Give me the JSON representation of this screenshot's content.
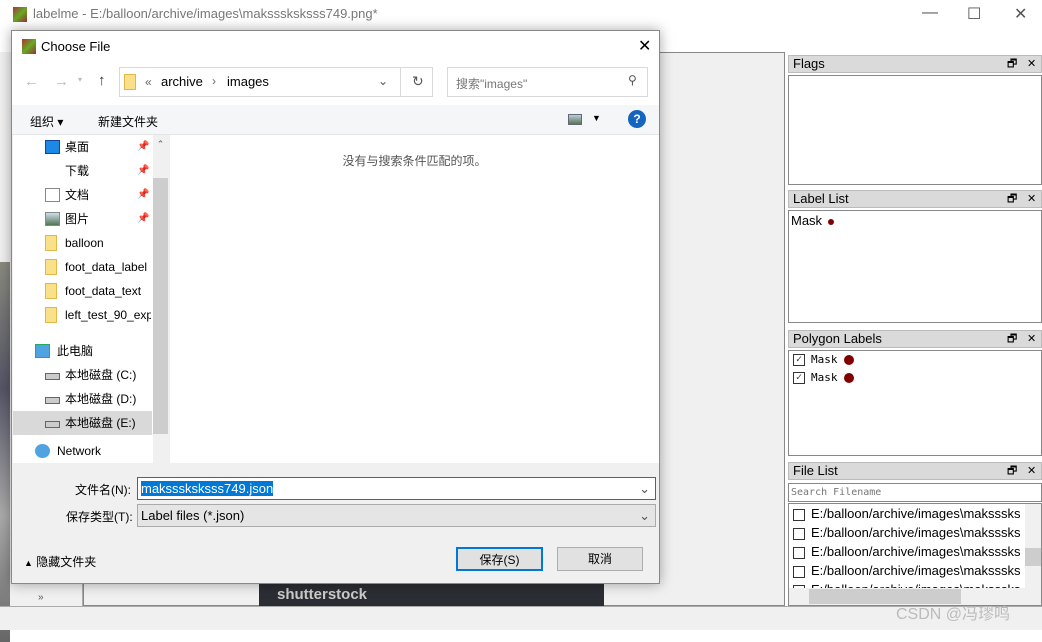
{
  "main_window": {
    "title": "labelme - E:/balloon/archive/images\\maksssksksss749.png*",
    "controls": {
      "minimize": "—",
      "maximize": "☐",
      "close": "✕"
    },
    "canvas_watermark": "shutterstock",
    "left_toolbar_more": "»"
  },
  "docks": {
    "flags": {
      "title": "Flags",
      "items": []
    },
    "label_list": {
      "title": "Label List",
      "items": [
        {
          "label": "Mask",
          "color": "#800000"
        }
      ]
    },
    "polygon_labels": {
      "title": "Polygon Labels",
      "items": [
        {
          "label": "Mask",
          "checked": true,
          "color": "#800000"
        },
        {
          "label": "Mask",
          "checked": true,
          "color": "#800000"
        }
      ]
    },
    "file_list": {
      "title": "File List",
      "search_placeholder": "Search Filename",
      "items": [
        "E:/balloon/archive/images\\maksssks",
        "E:/balloon/archive/images\\maksssks",
        "E:/balloon/archive/images\\maksssks",
        "E:/balloon/archive/images\\maksssks",
        "E:/balloon/archive/images\\maksssks"
      ]
    }
  },
  "dialog": {
    "title": "Choose File",
    "breadcrumb": [
      "«",
      "archive",
      "›",
      "images"
    ],
    "search_placeholder": "搜索\"images\"",
    "toolbar": {
      "organize": "组织 ▾",
      "new_folder": "新建文件夹",
      "help": "?"
    },
    "nav": [
      {
        "label": "桌面",
        "icon": "desktop-icon",
        "pinned": true
      },
      {
        "label": "下载",
        "icon": "download-icon",
        "pinned": true
      },
      {
        "label": "文档",
        "icon": "document-icon",
        "pinned": true
      },
      {
        "label": "图片",
        "icon": "pictures-icon",
        "pinned": true
      },
      {
        "label": "balloon",
        "icon": "folder-icon"
      },
      {
        "label": "foot_data_label",
        "icon": "folder-icon"
      },
      {
        "label": "foot_data_text",
        "icon": "folder-icon"
      },
      {
        "label": "left_test_90_exp",
        "icon": "folder-icon"
      },
      {
        "label": "此电脑",
        "icon": "computer-icon",
        "section": true
      },
      {
        "label": "本地磁盘 (C:)",
        "icon": "drive-icon"
      },
      {
        "label": "本地磁盘 (D:)",
        "icon": "drive-icon"
      },
      {
        "label": "本地磁盘 (E:)",
        "icon": "drive-icon",
        "selected": true
      },
      {
        "label": "Network",
        "icon": "network-icon",
        "section": true
      }
    ],
    "empty_message": "没有与搜索条件匹配的项。",
    "filename_label": "文件名(N):",
    "filename_value": "maksssksksss749.json",
    "filetype_label": "保存类型(T):",
    "filetype_value": "Label files (*.json)",
    "hide_folders": "隐藏文件夹",
    "save": "保存(S)",
    "cancel": "取消"
  },
  "watermark": "CSDN @冯璆鸣"
}
